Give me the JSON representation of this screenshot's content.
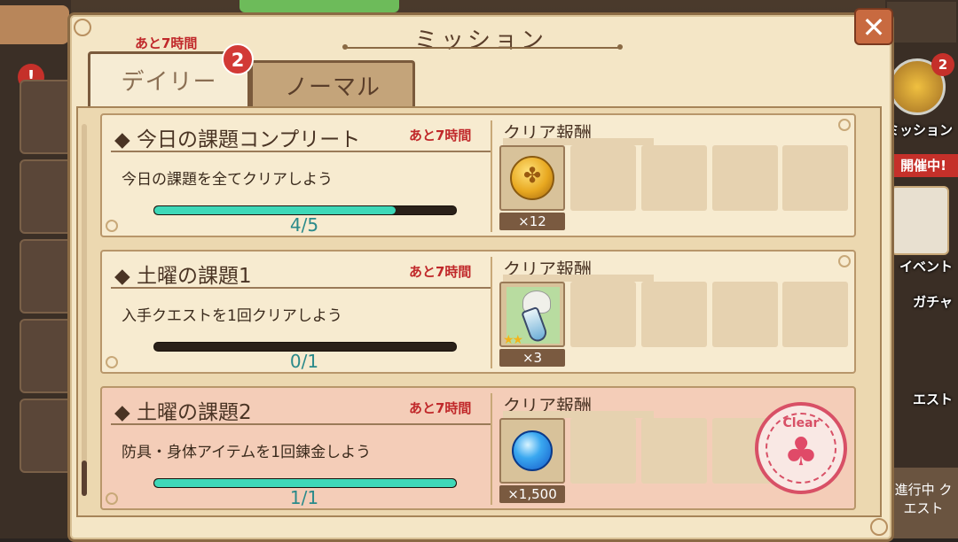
{
  "dialog": {
    "title": "ミッション",
    "close_label": "✕",
    "timer_top": "あと7時間"
  },
  "tabs": [
    {
      "label": "デイリー",
      "active": true,
      "badge": "2"
    },
    {
      "label": "ノーマル",
      "active": false
    }
  ],
  "missions": [
    {
      "name": "◆ 今日の課題コンプリート",
      "timer": "あと7時間",
      "description": "今日の課題を全てクリアしよう",
      "progress_text": "4/5",
      "progress": 0.8,
      "reward_label": "クリア報酬",
      "reward_icon": "clover-coin-icon",
      "reward_qty": "×12",
      "cleared": false
    },
    {
      "name": "◆ 土曜の課題1",
      "timer": "あと7時間",
      "description": "入手クエストを1回クリアしよう",
      "progress_text": "0/1",
      "progress": 0.0,
      "reward_label": "クリア報酬",
      "reward_icon": "potion-icon",
      "reward_qty": "×3",
      "cleared": false
    },
    {
      "name": "◆ 土曜の課題2",
      "timer": "あと7時間",
      "description": "防具・身体アイテムを1回錬金しよう",
      "progress_text": "1/1",
      "progress": 1.0,
      "reward_label": "クリア報酬",
      "reward_icon": "blue-orb-icon",
      "reward_qty": "×1,500",
      "cleared": true,
      "stamp_text": "Clear"
    }
  ],
  "background": {
    "mission_badge": "2",
    "mission_label": "ミッション",
    "event_banner": "開催中!",
    "event_label": "イベント",
    "gacha_label": "ガチャ",
    "quest_label": "エスト",
    "ongoing_quest": "進行中 クエスト"
  },
  "colors": {
    "accent_red": "#c0282a",
    "progress_fill": "#3ed8b8",
    "panel": "#f4e6c6",
    "cleared_card": "#f4cdb8"
  }
}
